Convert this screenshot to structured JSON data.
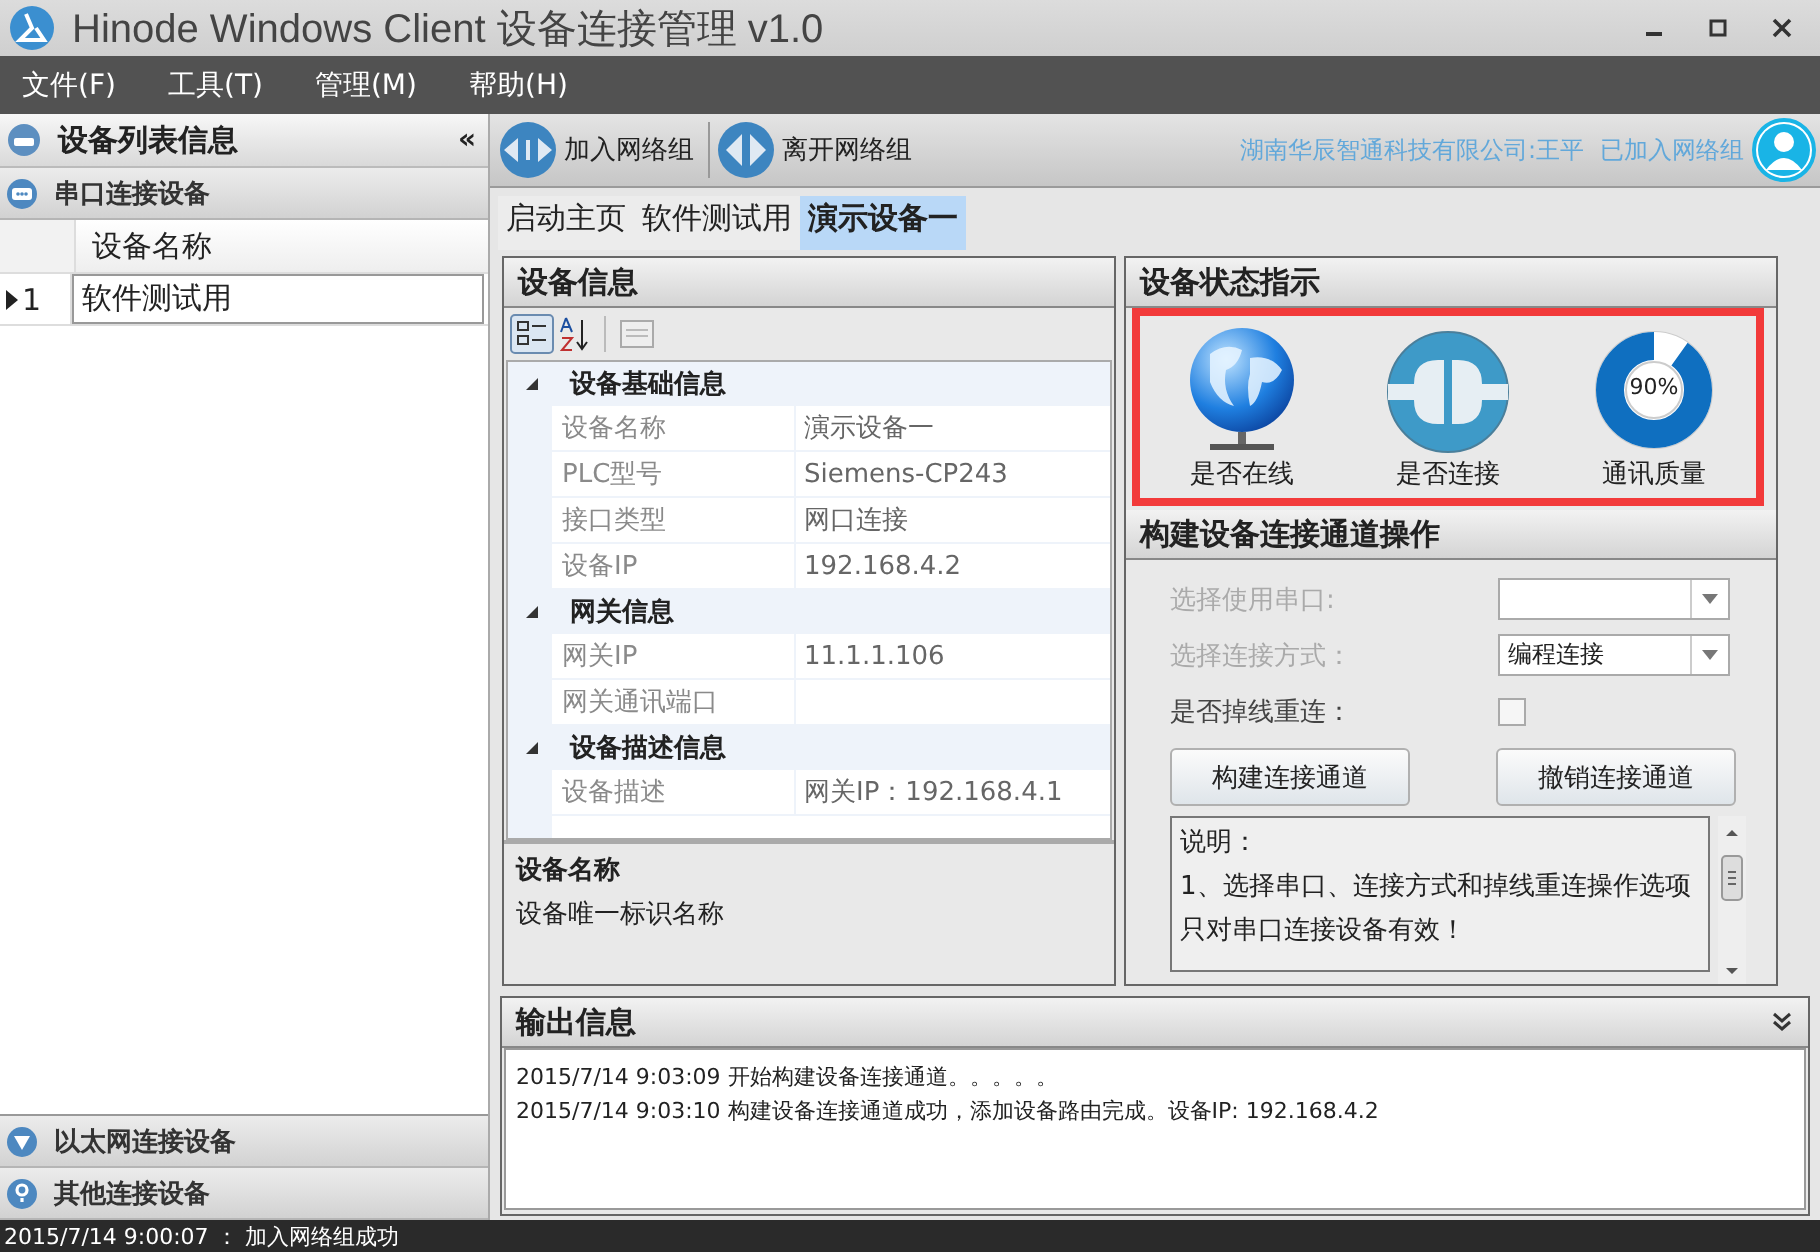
{
  "window": {
    "title": "Hinode Windows Client 设备连接管理 v1.0"
  },
  "menu": [
    "文件(F)",
    "工具(T)",
    "管理(M)",
    "帮助(H)"
  ],
  "sidebar": {
    "title": "设备列表信息",
    "collapse": "«",
    "groups": [
      {
        "label": "串口连接设备",
        "kind": "serial",
        "expanded": true,
        "columns": [
          "设备名称"
        ],
        "rows": [
          {
            "index": "1",
            "name": "软件测试用",
            "current": true
          }
        ]
      },
      {
        "label": "以太网连接设备",
        "kind": "ethernet",
        "expanded": false
      },
      {
        "label": "其他连接设备",
        "kind": "other",
        "expanded": false
      }
    ]
  },
  "toolbar": {
    "buttons": [
      {
        "label": "加入网络组",
        "kind": "join"
      },
      {
        "label": "离开网络组",
        "kind": "leave"
      }
    ],
    "user_info": "湖南华辰智通科技有限公司:王平",
    "network_status": "已加入网络组"
  },
  "tabs": [
    {
      "label": "启动主页",
      "selected": false
    },
    {
      "label": "软件测试用",
      "selected": false
    },
    {
      "label": "演示设备一",
      "selected": true
    }
  ],
  "device_info": {
    "title": "设备信息",
    "categories": [
      {
        "name": "设备基础信息",
        "expanded": true,
        "properties": [
          {
            "name": "设备名称",
            "value": "演示设备一"
          },
          {
            "name": "PLC型号",
            "value": "Siemens-CP243"
          },
          {
            "name": "接口类型",
            "value": "网口连接"
          },
          {
            "name": "设备IP",
            "value": "192.168.4.2"
          }
        ]
      },
      {
        "name": "网关信息",
        "expanded": true,
        "properties": [
          {
            "name": "网关IP",
            "value": "11.1.1.106"
          },
          {
            "name": "网关通讯端口"
          }
        ]
      },
      {
        "name": "设备描述信息",
        "expanded": true,
        "properties": [
          {
            "name": "设备描述",
            "value": "网关IP：192.168.4.1"
          }
        ]
      }
    ],
    "description": {
      "title": "设备名称",
      "text": "设备唯一标识名称"
    }
  },
  "status": {
    "title": "设备状态指示",
    "indicators": [
      {
        "kind": "online",
        "label": "是否在线"
      },
      {
        "kind": "connected",
        "label": "是否连接"
      },
      {
        "kind": "quality",
        "label": "通讯质量",
        "level": 0.9,
        "reading": "90%"
      }
    ]
  },
  "channel": {
    "title": "构建设备连接通道操作",
    "fields": [
      {
        "kind": "select",
        "label": "选择使用串口:",
        "disabled": true
      },
      {
        "kind": "select",
        "label": "选择连接方式：",
        "value": "编程连接",
        "disabled": true
      },
      {
        "kind": "checkbox",
        "label": "是否掉线重连：",
        "disabled": false,
        "checked": false
      }
    ],
    "buttons": [
      "构建连接通道",
      "撤销连接通道"
    ],
    "note": [
      "说明：",
      "1、选择串口、连接方式和掉线重连操作选项只对串口连接设备有效！"
    ]
  },
  "output": {
    "title": "输出信息",
    "lines": [
      "2015/7/14 9:03:09 开始构建设备连接通道。。。。。",
      "2015/7/14 9:03:10 构建设备连接通道成功，添加设备路由完成。设备IP:  192.168.4.2"
    ]
  },
  "status_bar": {
    "text": "2015/7/14 9:00:07 ： 加入网络组成功"
  }
}
